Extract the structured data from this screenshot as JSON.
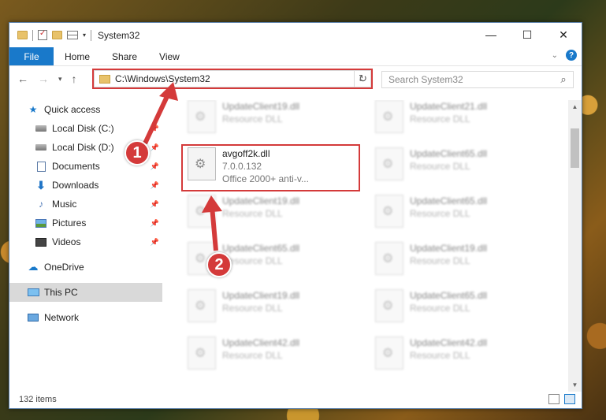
{
  "window": {
    "title": "System32",
    "controls": {
      "minimize": "—",
      "maximize": "☐",
      "close": "✕"
    }
  },
  "ribbon": {
    "tabs": [
      "File",
      "Home",
      "Share",
      "View"
    ]
  },
  "address": {
    "path": "C:\\Windows\\System32",
    "search_placeholder": "Search System32"
  },
  "sidebar": {
    "items": [
      {
        "label": "Quick access",
        "icon": "star-icon",
        "pinned": false
      },
      {
        "label": "Local Disk (C:)",
        "icon": "disk-icon",
        "pinned": true
      },
      {
        "label": "Local Disk (D:)",
        "icon": "disk-icon",
        "pinned": true
      },
      {
        "label": "Documents",
        "icon": "documents-icon",
        "pinned": true
      },
      {
        "label": "Downloads",
        "icon": "download-icon",
        "pinned": true
      },
      {
        "label": "Music",
        "icon": "music-icon",
        "pinned": true
      },
      {
        "label": "Pictures",
        "icon": "pictures-icon",
        "pinned": true
      },
      {
        "label": "Videos",
        "icon": "videos-icon",
        "pinned": true
      },
      {
        "label": "OneDrive",
        "icon": "cloud-icon",
        "pinned": false
      },
      {
        "label": "This PC",
        "icon": "computer-icon",
        "pinned": false,
        "selected": true
      },
      {
        "label": "Network",
        "icon": "network-icon",
        "pinned": false
      }
    ]
  },
  "files": {
    "highlighted": {
      "name": "avgoff2k.dll",
      "version": "7.0.0.132",
      "description": "Office 2000+ anti-v..."
    },
    "blurred_left": [
      {
        "name": "UpdateClient19.dll",
        "sub": "Resource DLL"
      },
      {
        "name": "UpdateClient19.dll",
        "sub": "Resource DLL"
      },
      {
        "name": "UpdateClient65.dll",
        "sub": "Resource DLL"
      },
      {
        "name": "UpdateClient19.dll",
        "sub": "Resource DLL"
      },
      {
        "name": "UpdateClient42.dll",
        "sub": "Resource DLL"
      }
    ],
    "blurred_right": [
      {
        "name": "UpdateClient21.dll",
        "sub": "Resource DLL"
      },
      {
        "name": "UpdateClient65.dll",
        "sub": "Resource DLL"
      },
      {
        "name": "UpdateClient65.dll",
        "sub": "Resource DLL"
      },
      {
        "name": "UpdateClient19.dll",
        "sub": "Resource DLL"
      },
      {
        "name": "UpdateClient65.dll",
        "sub": "Resource DLL"
      },
      {
        "name": "UpdateClient42.dll",
        "sub": "Resource DLL"
      }
    ]
  },
  "status": {
    "item_count": "132 items"
  },
  "annotations": {
    "step1": "1",
    "step2": "2",
    "color": "#d43a3a"
  }
}
